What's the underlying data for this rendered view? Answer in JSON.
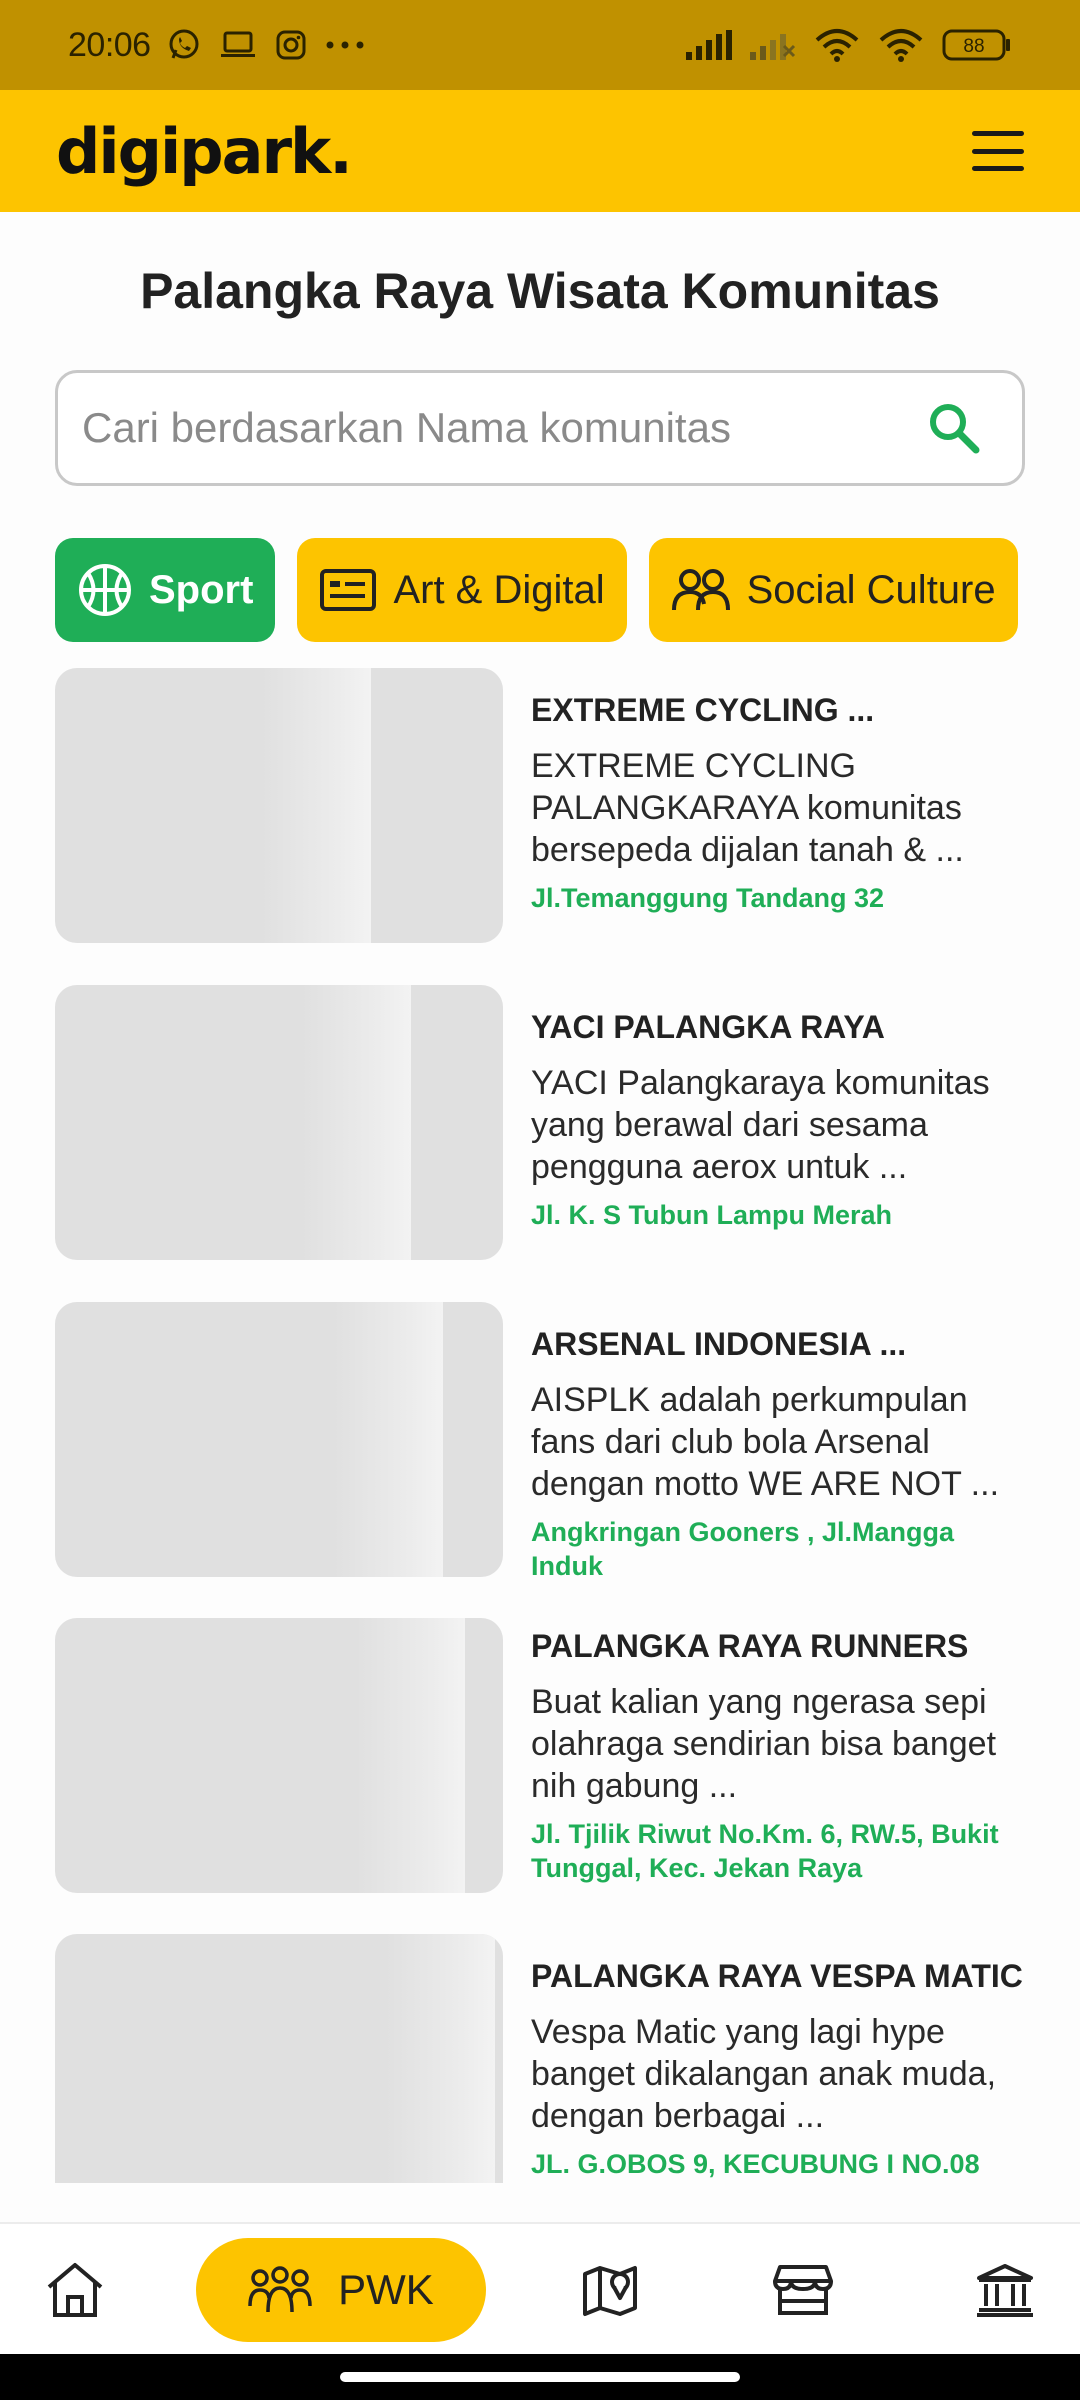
{
  "status_bar": {
    "time": "20:06",
    "battery": "88",
    "left_icons": [
      "whatsapp-icon",
      "laptop-icon",
      "instagram-icon",
      "more-dots-icon"
    ],
    "right_icons": [
      "signal-icon",
      "signal-weak-icon",
      "wifi-icon",
      "wifi-icon",
      "battery-icon"
    ]
  },
  "header": {
    "logo": "digipark.",
    "menu_icon": "hamburger-icon"
  },
  "page": {
    "title": "Palangka Raya Wisata Komunitas"
  },
  "search": {
    "placeholder": "Cari berdasarkan Nama komunitas",
    "value": "",
    "icon": "search-icon"
  },
  "categories": [
    {
      "label": "Sport",
      "icon": "basketball-icon",
      "active": true
    },
    {
      "label": "Art & Digital",
      "icon": "id-card-icon",
      "active": false
    },
    {
      "label": "Social Culture",
      "icon": "people-icon",
      "active": false
    },
    {
      "label": "",
      "icon": "briefcase-icon",
      "active": false
    }
  ],
  "communities": [
    {
      "title": "EXTREME CYCLING ...",
      "description": "EXTREME CYCLING PALANGKARAYA komunitas bersepeda dijalan tanah & ...",
      "address": "Jl.Temanggung Tandang 32"
    },
    {
      "title": "YACI PALANGKA RAYA",
      "description": "YACI Palangkaraya komunitas yang berawal dari sesama pengguna aerox untuk ...",
      "address": "Jl. K. S Tubun Lampu Merah"
    },
    {
      "title": "ARSENAL INDONESIA ...",
      "description": "AISPLK adalah perkumpulan fans dari club bola  Arsenal dengan motto  WE ARE NOT ...",
      "address": "Angkringan Gooners , Jl.Mangga Induk"
    },
    {
      "title": "PALANGKA RAYA RUNNERS",
      "description": "Buat kalian yang ngerasa sepi olahraga sendirian bisa banget nih gabung ...",
      "address": "Jl. Tjilik Riwut No.Km. 6, RW.5, Bukit Tunggal, Kec. Jekan Raya"
    },
    {
      "title": "PALANGKA RAYA VESPA MATIC",
      "description": "Vespa Matic yang lagi hype banget dikalangan anak muda, dengan berbagai ...",
      "address": "JL. G.OBOS 9, KECUBUNG I NO.08"
    }
  ],
  "bottom_nav": {
    "items": [
      {
        "icon": "home-icon"
      },
      {
        "icon": "community-icon",
        "label": "PWK",
        "active": true
      },
      {
        "icon": "map-icon"
      },
      {
        "icon": "store-icon"
      },
      {
        "icon": "museum-icon"
      }
    ]
  },
  "colors": {
    "brand_yellow": "#fdc400",
    "status_bar": "#c09100",
    "accent_green": "#1fae57",
    "placeholder_gray": "#e0e0e0"
  }
}
